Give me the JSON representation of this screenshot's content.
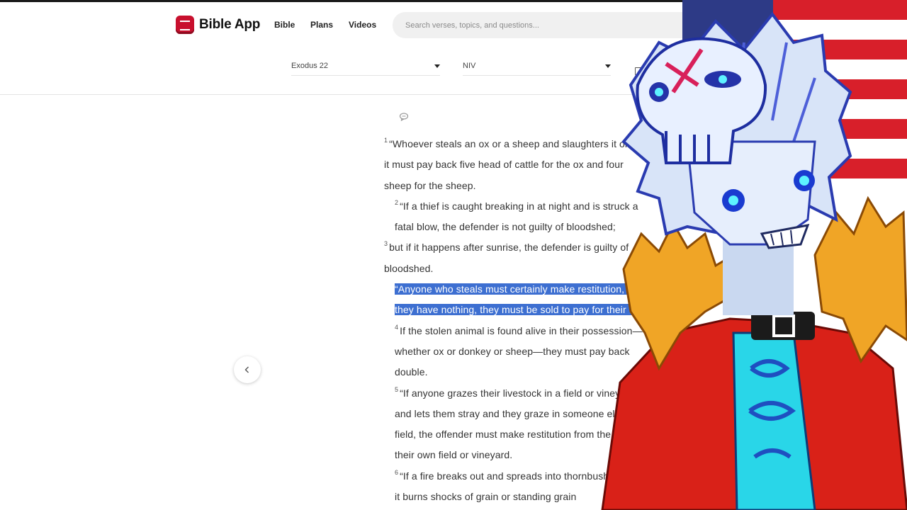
{
  "header": {
    "app_name": "Bible App",
    "nav": [
      "Bible",
      "Plans",
      "Videos"
    ],
    "search_placeholder": "Search verses, topics, and questions..."
  },
  "selectors": {
    "chapter": "Exodus 22",
    "version": "NIV"
  },
  "icons": {
    "logo": "bible-app-logo-icon",
    "comment": "comment-icon",
    "prev": "chevron-left-icon",
    "caret": "caret-down-icon"
  },
  "colors": {
    "logo_red": "#c8102e",
    "highlight": "#3d6fd1"
  },
  "passage": {
    "v1": {
      "num": "1",
      "text": "“Whoever steals an ox or a sheep and slaughters it or sells it must pay back five head of cattle for the ox and four sheep for the sheep."
    },
    "v2": {
      "num": "2",
      "text": "“If a thief is caught breaking in at night and is struck a fatal blow, the defender is not guilty of bloodshed;"
    },
    "v3": {
      "num": "3",
      "text": "but if it happens after sunrise, the defender is guilty of bloodshed."
    },
    "v3b_selected": "“Anyone who steals must certainly make restitution, but if they have nothing, they must be sold to pay for their theft.",
    "v4": {
      "num": "4",
      "text": "If the stolen animal is found alive in their possession—whether ox or donkey or sheep—they must pay back double."
    },
    "v5": {
      "num": "5",
      "text": "“If anyone grazes their livestock in a field or vineyard and lets them stray and they graze in someone else’s field, the offender must make restitution from the best of their own field or vineyard."
    },
    "v6": {
      "num": "6",
      "text": "“If a fire breaks out and spreads into thornbushes so that it burns shocks of grain or standing grain"
    }
  }
}
